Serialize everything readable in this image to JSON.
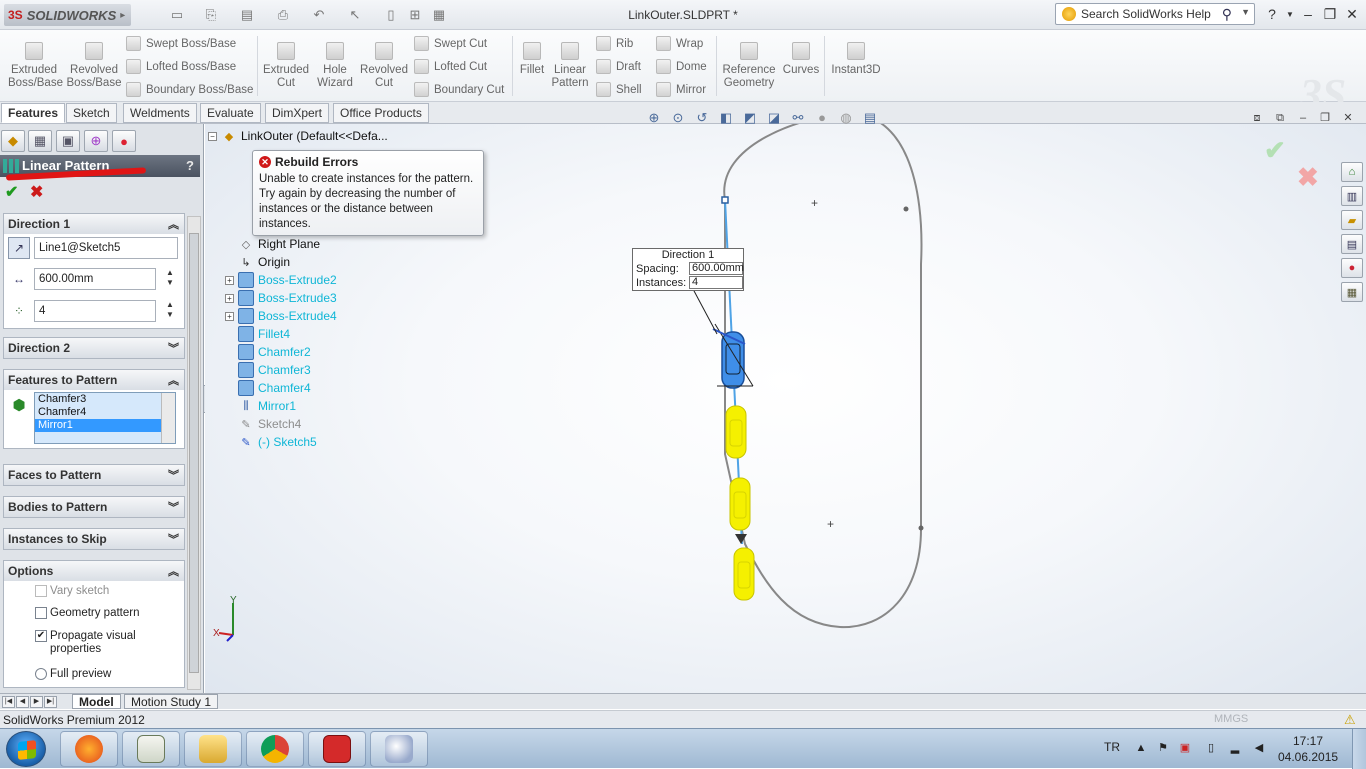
{
  "app": {
    "logo_text": "SOLIDWORKS",
    "doc_title": "LinkOuter.SLDPRT *",
    "help_search_placeholder": "Search SolidWorks Help",
    "help_label": "?"
  },
  "ribbon": {
    "extruded_boss": "Extruded Boss/Base",
    "revolved_boss": "Revolved Boss/Base",
    "swept_boss": "Swept Boss/Base",
    "lofted_boss": "Lofted Boss/Base",
    "boundary_boss": "Boundary Boss/Base",
    "extruded_cut": "Extruded Cut",
    "hole_wizard": "Hole Wizard",
    "revolved_cut": "Revolved Cut",
    "swept_cut": "Swept Cut",
    "lofted_cut": "Lofted Cut",
    "boundary_cut": "Boundary Cut",
    "fillet": "Fillet",
    "linear_pattern": "Linear Pattern",
    "rib": "Rib",
    "draft": "Draft",
    "shell": "Shell",
    "wrap": "Wrap",
    "dome": "Dome",
    "mirror": "Mirror",
    "reference_geometry": "Reference Geometry",
    "curves": "Curves",
    "instant3d": "Instant3D"
  },
  "tabs": [
    "Features",
    "Sketch",
    "Weldments",
    "Evaluate",
    "DimXpert",
    "Office Products"
  ],
  "property_manager": {
    "title": "Linear Pattern",
    "help": "?",
    "direction1": {
      "header": "Direction 1",
      "direction_ref": "Line1@Sketch5",
      "spacing": "600.00mm",
      "instances": "4"
    },
    "direction2_header": "Direction 2",
    "features_header": "Features to Pattern",
    "features": [
      "Chamfer3",
      "Chamfer4",
      "Mirror1"
    ],
    "selected_feature": "Mirror1",
    "faces_header": "Faces to Pattern",
    "bodies_header": "Bodies to Pattern",
    "skip_header": "Instances to Skip",
    "options": {
      "header": "Options",
      "vary_sketch": "Vary sketch",
      "vary_sketch_checked": false,
      "geometry_pattern": "Geometry pattern",
      "geometry_pattern_checked": false,
      "propagate": "Propagate visual properties",
      "propagate_checked": true,
      "full_preview": "Full preview"
    }
  },
  "tree": {
    "root": "LinkOuter  (Default<<Defa...",
    "right_plane": "Right Plane",
    "origin": "Origin",
    "items": [
      {
        "label": "Boss-Extrude2",
        "expandable": true
      },
      {
        "label": "Boss-Extrude3",
        "expandable": true
      },
      {
        "label": "Boss-Extrude4",
        "expandable": true
      },
      {
        "label": "Fillet4",
        "expandable": false
      },
      {
        "label": "Chamfer2",
        "expandable": false
      },
      {
        "label": "Chamfer3",
        "expandable": false
      },
      {
        "label": "Chamfer4",
        "expandable": false
      },
      {
        "label": "Mirror1",
        "expandable": false
      },
      {
        "label": "Sketch4",
        "expandable": false
      },
      {
        "label": "(-) Sketch5",
        "expandable": false
      }
    ]
  },
  "error_tooltip": {
    "title": "Rebuild Errors",
    "body": "Unable to create instances for the pattern. Try again by decreasing the number of instances or the distance between instances."
  },
  "callout": {
    "title": "Direction 1",
    "spacing_label": "Spacing:",
    "spacing_value": "600.00mm",
    "instances_label": "Instances:",
    "instances_value": "4"
  },
  "bottom_tabs": [
    "Model",
    "Motion Study 1"
  ],
  "status": {
    "text": "SolidWorks Premium 2012",
    "units": "MMGS"
  },
  "taskbar": {
    "language": "TR",
    "time": "17:17",
    "date": "04.06.2015"
  },
  "colors": {
    "accent_blue": "#2b7fd6",
    "pattern_preview_yellow": "#f5f000",
    "error_red": "#d01818",
    "tree_feature_cyan": "#0fb6d6"
  }
}
